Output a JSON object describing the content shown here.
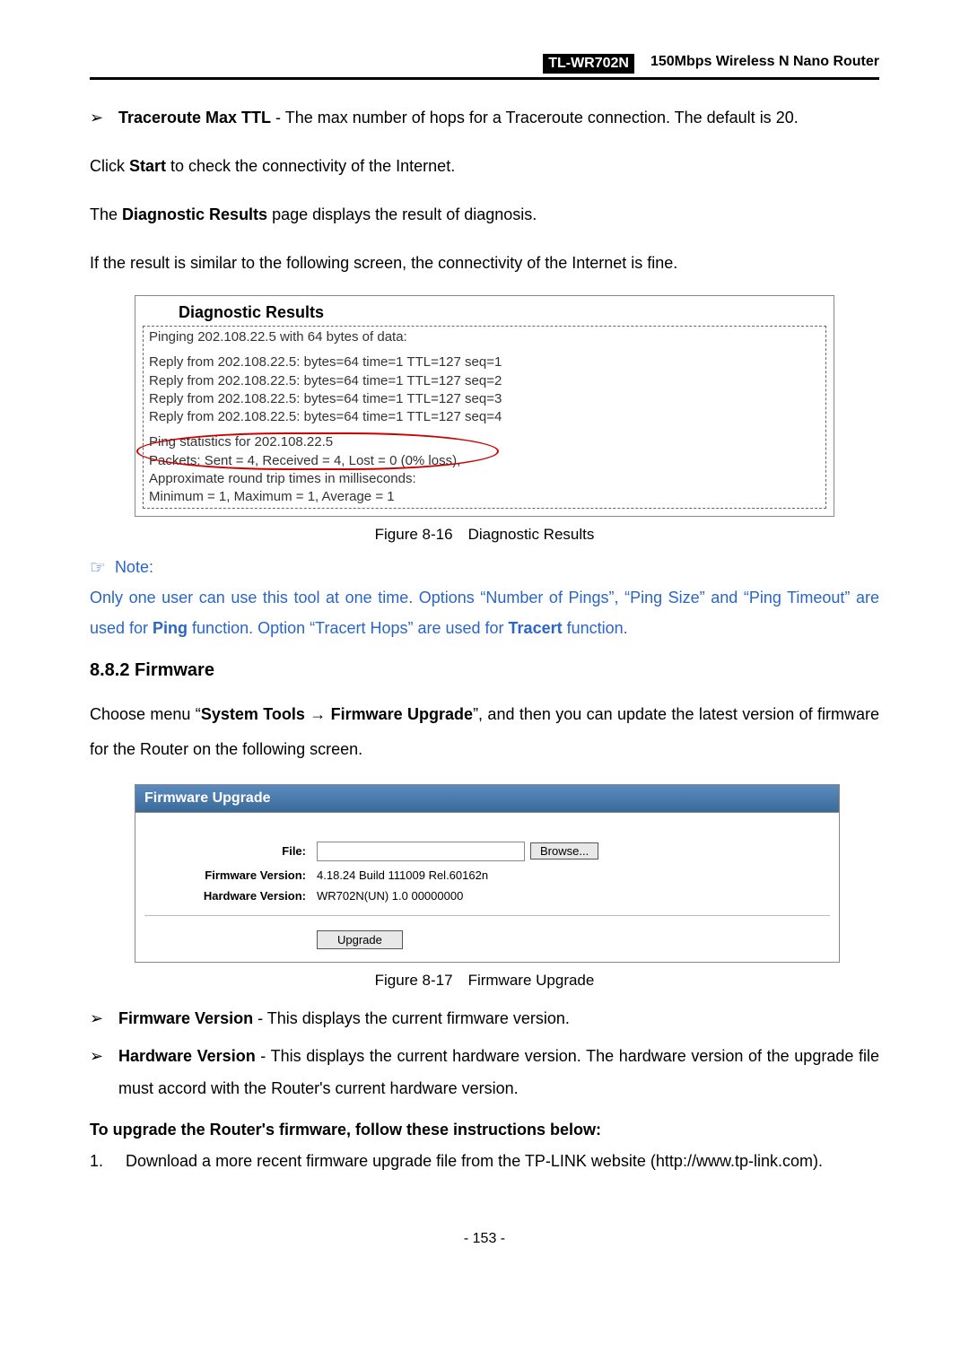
{
  "header": {
    "model": "TL-WR702N",
    "desc": "150Mbps Wireless N Nano Router"
  },
  "bullets": {
    "traceroute": {
      "label": "Traceroute Max TTL",
      "text": " - The max number of hops for a Traceroute connection. The default is 20."
    },
    "fw_version": {
      "label": "Firmware Version",
      "text": " - This displays the current firmware version."
    },
    "hw_version": {
      "label": "Hardware Version",
      "text": " - This displays the current hardware version. The hardware version of the upgrade file must accord with the Router's current hardware version."
    }
  },
  "body": {
    "click_start_pre": "Click ",
    "click_start_bold": "Start",
    "click_start_post": " to check the connectivity of the Internet.",
    "diag_results_pre": "The ",
    "diag_results_bold": "Diagnostic Results",
    "diag_results_post": " page displays the result of diagnosis.",
    "similar_line": "If the result is similar to the following screen, the connectivity of the Internet is fine.",
    "firmware_intro_1": "Choose menu “",
    "firmware_intro_bold1": "System Tools",
    "firmware_intro_arrow": " → ",
    "firmware_intro_bold2": "Firmware Upgrade",
    "firmware_intro_2": "”, and then you can update the latest version of firmware for the Router on the following screen."
  },
  "diag": {
    "title": "Diagnostic Results",
    "line0": "Pinging 202.108.22.5 with 64 bytes of data:",
    "r1": "Reply from 202.108.22.5:  bytes=64  time=1  TTL=127  seq=1",
    "r2": "Reply from 202.108.22.5:  bytes=64  time=1  TTL=127  seq=2",
    "r3": "Reply from 202.108.22.5:  bytes=64  time=1  TTL=127  seq=3",
    "r4": "Reply from 202.108.22.5:  bytes=64  time=1  TTL=127  seq=4",
    "s1": "Ping statistics for 202.108.22.5",
    "s2": "  Packets: Sent = 4, Received = 4, Lost = 0 (0% loss),",
    "s3": "Approximate round trip times in milliseconds:",
    "s4": "  Minimum = 1, Maximum = 1, Average = 1"
  },
  "captions": {
    "fig16": "Figure 8-16 Diagnostic Results",
    "fig17": "Figure 8-17 Firmware Upgrade"
  },
  "note": {
    "label": "Note:",
    "text_pre": "Only one user can use this tool at one time. Options “Number of Pings”, “Ping Size” and “Ping Timeout” are used for ",
    "bold1": "Ping",
    "text_mid": " function. Option “Tracert Hops” are used for ",
    "bold2": "Tracert",
    "text_post": " function."
  },
  "section": {
    "num_title": "8.8.2  Firmware"
  },
  "fw_panel": {
    "title": "Firmware Upgrade",
    "file_label": "File:",
    "browse": "Browse...",
    "fw_label": "Firmware Version:",
    "fw_value": "4.18.24 Build 111009 Rel.60162n",
    "hw_label": "Hardware Version:",
    "hw_value": "WR702N(UN) 1.0 00000000",
    "upgrade": "Upgrade"
  },
  "instructions": {
    "heading": "To upgrade the Router's firmware, follow these instructions below:",
    "n1_num": "1.",
    "n1_text": "Download a more recent firmware upgrade file from the TP-LINK website (http://www.tp-link.com)."
  },
  "page_num": "- 153 -"
}
